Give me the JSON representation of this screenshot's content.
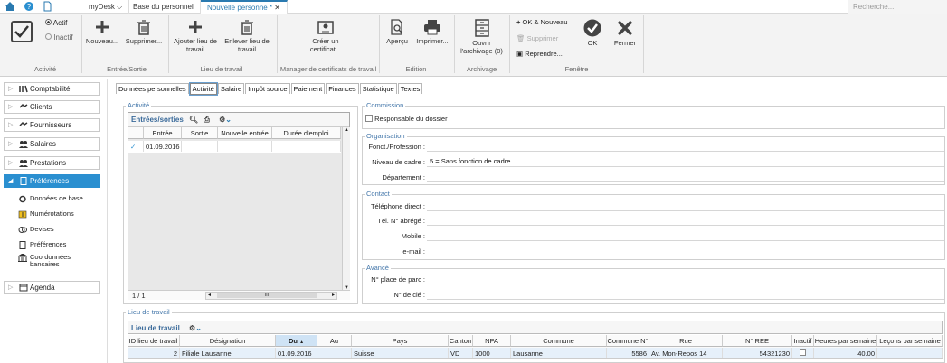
{
  "topbar": {
    "tabs": [
      {
        "label": "myDesk"
      },
      {
        "label": "Base du personnel"
      },
      {
        "label": "Nouvelle personne *"
      }
    ],
    "search_placeholder": "Recherche..."
  },
  "ribbon": {
    "actif": "Actif",
    "inactif": "Inactif",
    "nouveau": "Nouveau...",
    "supprimer": "Supprimer...",
    "ajouter_lieu": "Ajouter lieu de travail",
    "enlever_lieu": "Enlever lieu de travail",
    "creer_certificat": "Créer un certificat...",
    "apercu": "Aperçu",
    "imprimer": "Imprimer...",
    "ouvrir_archivage": "Ouvrir l'archivage (0)",
    "ok_nouveau": "OK & Nouveau",
    "supprimer2": "Supprimer",
    "reprendre": "Reprendre...",
    "ok": "OK",
    "fermer": "Fermer",
    "groups": {
      "activite": "Activité",
      "entree_sortie": "Entrée/Sortie",
      "lieu": "Lieu de travail",
      "certificats": "Manager de certificats de travail",
      "edition": "Edition",
      "archivage": "Archivage",
      "fenetre": "Fenêtre"
    }
  },
  "sidebar": {
    "items": [
      {
        "label": "Comptabilité"
      },
      {
        "label": "Clients"
      },
      {
        "label": "Fournisseurs"
      },
      {
        "label": "Salaires"
      },
      {
        "label": "Prestations"
      },
      {
        "label": "Préférences"
      },
      {
        "label": "Agenda"
      }
    ],
    "sub": [
      {
        "label": "Données de base"
      },
      {
        "label": "Numérotations"
      },
      {
        "label": "Devises"
      },
      {
        "label": "Préférences"
      },
      {
        "label": "Coordonnées bancaires"
      }
    ]
  },
  "doc_tabs": [
    {
      "label": "Données personnelles"
    },
    {
      "label": "Activité"
    },
    {
      "label": "Salaire"
    },
    {
      "label": "Impôt source"
    },
    {
      "label": "Paiement"
    },
    {
      "label": "Finances"
    },
    {
      "label": "Statistique"
    },
    {
      "label": "Textes"
    }
  ],
  "activite": {
    "legend": "Activité",
    "header": "Entrées/sorties",
    "cols": [
      "Entrée",
      "Sortie",
      "Nouvelle entrée",
      "Durée d'emploi"
    ],
    "row": {
      "entree": "01.09.2016"
    },
    "pager": "1 / 1",
    "scroll_mid": "III"
  },
  "commission": {
    "legend": "Commission",
    "responsable": "Responsable du dossier"
  },
  "organisation": {
    "legend": "Organisation",
    "fonction_label": "Fonct./Profession :",
    "niveau_label": "Niveau de cadre :",
    "niveau_value": "5 = Sans fonction de cadre",
    "departement_label": "Département :"
  },
  "contact": {
    "legend": "Contact",
    "tel_direct": "Téléphone direct :",
    "tel_abrege": "Tél. N° abrégé :",
    "mobile": "Mobile :",
    "email": "e-mail :"
  },
  "avance": {
    "legend": "Avancé",
    "place_parc": "N° place de parc :",
    "cle": "N° de clé :"
  },
  "lieu": {
    "legend": "Lieu de travail",
    "header": "Lieu de travail",
    "cols": [
      "ID lieu de travail",
      "Désignation",
      "Du",
      "Au",
      "Pays",
      "Canton",
      "NPA",
      "Commune",
      "Commune N°",
      "Rue",
      "N° REE",
      "Inactif",
      "Heures par semaine",
      "Leçons par semaine"
    ],
    "row": [
      "2",
      "Filiale Lausanne",
      "01.09.2016",
      "",
      "Suisse",
      "VD",
      "1000",
      "Lausanne",
      "5586",
      "Av. Mon-Repos 14",
      "54321230",
      "",
      "40.00",
      ""
    ]
  }
}
